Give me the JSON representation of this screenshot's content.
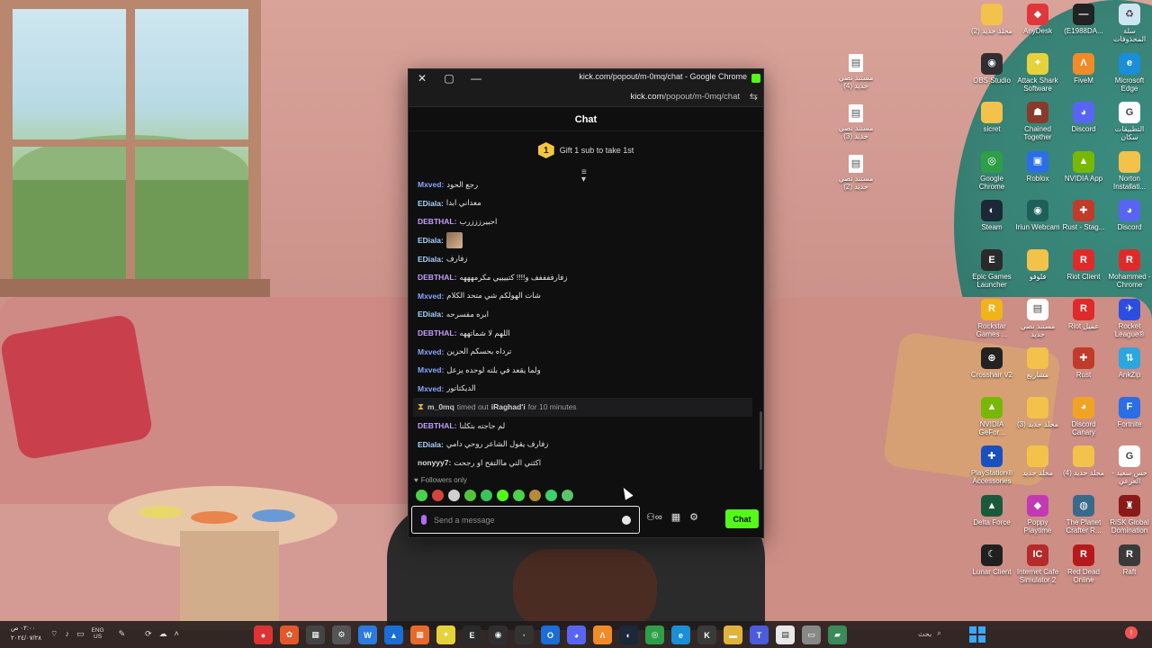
{
  "popup": {
    "title": "kick.com/popout/m-0mq/chat - Google Chrome",
    "url_host": "kick.com",
    "url_path": "/popout/m-0mq/chat",
    "chat_header": "Chat",
    "gift_count": "1",
    "gift_text": "Gift 1 sub to take 1st",
    "followers_only": "Followers only",
    "input_placeholder": "Send a message",
    "chat_button": "Chat",
    "accent": "#53fc18"
  },
  "messages": [
    {
      "user": "Mxved:",
      "text": "رجع الحود",
      "color": "#8aa6ff"
    },
    {
      "user": "EDiala:",
      "text": "معداني ابدا",
      "color": "#a6d2ff"
    },
    {
      "user": "DEBTHAL:",
      "text": "احبيرزززرب",
      "color": "#c79cff"
    },
    {
      "user": "EDiala:",
      "text": "",
      "color": "#a6d2ff",
      "emote": true
    },
    {
      "user": "EDiala:",
      "text": "زفارف",
      "color": "#a6d2ff"
    },
    {
      "user": "DEBTHAL:",
      "text": "زفارففففف و!!!! كتييييي مكرمهههه",
      "color": "#c79cff"
    },
    {
      "user": "Mxved:",
      "text": "شات الهولكم شي متحد الكلام",
      "color": "#8aa6ff"
    },
    {
      "user": "EDiala:",
      "text": "ابره مفسرحه",
      "color": "#a6d2ff"
    },
    {
      "user": "DEBTHAL:",
      "text": "اللهم لا شماتههه",
      "color": "#c79cff"
    },
    {
      "user": "Mxved:",
      "text": "ترداه بحسكم الحزين",
      "color": "#8aa6ff"
    },
    {
      "user": "Mxved:",
      "text": "ولما يقعد في بلته لوحده يزعل",
      "color": "#8aa6ff"
    },
    {
      "user": "Mxved:",
      "text": "الديكتاتور",
      "color": "#8aa6ff"
    },
    {
      "system": true,
      "mod": "m_0mq",
      "action": "timed out",
      "target": "iRaghad'i",
      "duration": "for 10 minutes"
    },
    {
      "user": "DEBTHAL:",
      "text": "لم حاجته بتكلنا",
      "color": "#c79cff"
    },
    {
      "user": "EDiala:",
      "text": "زفارف يقول الشاعر روحي دامي",
      "color": "#a6d2ff"
    },
    {
      "user": "nonyyy7:",
      "text": "اكثني التي ماالتفح او رجحت",
      "color": "#dddddd"
    }
  ],
  "desktop_icons": [
    {
      "label": "(2) مجلد جديد",
      "color": "#f2c24b",
      "glyph": ""
    },
    {
      "label": "AnyDesk",
      "color": "#e0373b",
      "glyph": "◆"
    },
    {
      "label": "(E1988DA...",
      "color": "#222222",
      "glyph": "—"
    },
    {
      "label": "سلة المحذوفات",
      "color": "#cfe6f2",
      "glyph": "♻"
    },
    {
      "label": "OBS Studio",
      "color": "#302e31",
      "glyph": "◉"
    },
    {
      "label": "Attack Shark Software",
      "color": "#e6d23a",
      "glyph": "✦"
    },
    {
      "label": "FiveM",
      "color": "#f28a28",
      "glyph": "Λ"
    },
    {
      "label": "Microsoft Edge",
      "color": "#1a8ed6",
      "glyph": "e"
    },
    {
      "label": "sicret",
      "color": "#f2c24b",
      "glyph": ""
    },
    {
      "label": "Chained Together",
      "color": "#8a3a2a",
      "glyph": "☗"
    },
    {
      "label": "Discord",
      "color": "#5865f2",
      "glyph": "◕"
    },
    {
      "label": "التطبيقات سكان",
      "color": "#ffffff",
      "glyph": "G"
    },
    {
      "label": "Google Chrome",
      "color": "#2e9e48",
      "glyph": "◎"
    },
    {
      "label": "Roblox",
      "color": "#2a6ee8",
      "glyph": "▣"
    },
    {
      "label": "NVIDIA App",
      "color": "#76b900",
      "glyph": "▲"
    },
    {
      "label": "Norton Installati...",
      "color": "#f2c24b",
      "glyph": ""
    },
    {
      "label": "Steam",
      "color": "#1b2838",
      "glyph": "◐"
    },
    {
      "label": "Iriun Webcam",
      "color": "#1f5f5a",
      "glyph": "◉"
    },
    {
      "label": "Rust - Stag...",
      "color": "#c23a2a",
      "glyph": "✚"
    },
    {
      "label": "Discord",
      "color": "#5865f2",
      "glyph": "◕"
    },
    {
      "label": "Epic Games Launcher",
      "color": "#2a2a2a",
      "glyph": "E"
    },
    {
      "label": "فلوفو",
      "color": "#f2c24b",
      "glyph": ""
    },
    {
      "label": "Riot Client",
      "color": "#e02a2a",
      "glyph": "R"
    },
    {
      "label": "Mohammed - Chrome",
      "color": "#e02a2a",
      "glyph": "R"
    },
    {
      "label": "Rockstar Games ...",
      "color": "#f2b31a",
      "glyph": "R"
    },
    {
      "label": "مستند نصي جديد",
      "color": "#ffffff",
      "glyph": "▤"
    },
    {
      "label": "Riot عميل",
      "color": "#e02a2a",
      "glyph": "R"
    },
    {
      "label": "Rocket League®",
      "color": "#2a4fe0",
      "glyph": "✈"
    },
    {
      "label": "Crosshair V2",
      "color": "#222222",
      "glyph": "⊕"
    },
    {
      "label": "مشاريع",
      "color": "#f2c24b",
      "glyph": ""
    },
    {
      "label": "Rust",
      "color": "#c23a2a",
      "glyph": "✚"
    },
    {
      "label": "AnkZip",
      "color": "#2aa6e0",
      "glyph": "⇅"
    },
    {
      "label": "NVIDIA GeFor...",
      "color": "#76b900",
      "glyph": "▲"
    },
    {
      "label": "(3) مجلد جديد",
      "color": "#f2c24b",
      "glyph": ""
    },
    {
      "label": "Discord Canary",
      "color": "#f2a324",
      "glyph": "◕"
    },
    {
      "label": "Fortnite",
      "color": "#2a6ee8",
      "glyph": "F"
    },
    {
      "label": "PlayStation® Accessories",
      "color": "#1a4fbf",
      "glyph": "✚"
    },
    {
      "label": "مجلد جديد",
      "color": "#f2c24b",
      "glyph": ""
    },
    {
      "label": "(4) مجلد جديد",
      "color": "#f2c24b",
      "glyph": ""
    },
    {
      "label": "حس سعيد - العرعي",
      "color": "#ffffff",
      "glyph": "G"
    },
    {
      "label": "Delta Force",
      "color": "#1a5a3a",
      "glyph": "▲"
    },
    {
      "label": "Poppy Playtime",
      "color": "#c23ab3",
      "glyph": "◆"
    },
    {
      "label": "The Planet Crafter R...",
      "color": "#3a6a8a",
      "glyph": "◍"
    },
    {
      "label": "RiSK Global Domination",
      "color": "#8a1a1a",
      "glyph": "♜"
    },
    {
      "label": "Lunar Client",
      "color": "#202020",
      "glyph": "☾"
    },
    {
      "label": "Internet Cafe Simulator 2",
      "color": "#b52a2a",
      "glyph": "IC"
    },
    {
      "label": "Red Dead Online",
      "color": "#b51a1a",
      "glyph": "R"
    },
    {
      "label": "Raft",
      "color": "#3a3a3a",
      "glyph": "R"
    }
  ],
  "desktop_mid_icons": [
    {
      "label": "مستند نصي جديد (4)"
    },
    {
      "label": "مستند نصي جديد (3)"
    },
    {
      "label": "مستند نصي جديد (2)"
    }
  ],
  "taskbar": {
    "clock_time": "٠٢:٠٠ ص",
    "clock_date": "٢٠٢٤/٠٧/٢٨",
    "lang_top": "ENG",
    "lang_bottom": "US",
    "search_label": "بحث",
    "apps": [
      {
        "name": "recorder",
        "color": "#d33",
        "glyph": "●"
      },
      {
        "name": "app-colorful",
        "color": "#e5562a",
        "glyph": "✿"
      },
      {
        "name": "app-calc",
        "color": "#444",
        "glyph": "▦"
      },
      {
        "name": "app-settings",
        "color": "#555",
        "glyph": "⚙"
      },
      {
        "name": "app-w",
        "color": "#2a7ae0",
        "glyph": "W"
      },
      {
        "name": "app-store",
        "color": "#1a6ed6",
        "glyph": "▲"
      },
      {
        "name": "app-windows",
        "color": "#e86a2a",
        "glyph": "▦"
      },
      {
        "name": "app-attack",
        "color": "#e6d23a",
        "glyph": "✦"
      },
      {
        "name": "app-epic",
        "color": "#2a2a2a",
        "glyph": "E"
      },
      {
        "name": "app-obs",
        "color": "#302e31",
        "glyph": "◉"
      },
      {
        "name": "app-dot",
        "color": "#333",
        "glyph": "·"
      },
      {
        "name": "app-outlook",
        "color": "#1a6ed6",
        "glyph": "O"
      },
      {
        "name": "app-discord",
        "color": "#5865f2",
        "glyph": "◕"
      },
      {
        "name": "app-fivem",
        "color": "#f28a28",
        "glyph": "Λ"
      },
      {
        "name": "app-steam",
        "color": "#1b2838",
        "glyph": "◐"
      },
      {
        "name": "app-chrome",
        "color": "#2e9e48",
        "glyph": "◎"
      },
      {
        "name": "app-edge",
        "color": "#1a8ed6",
        "glyph": "e"
      },
      {
        "name": "app-kick",
        "color": "#3a3a3a",
        "glyph": "K"
      },
      {
        "name": "app-explorer",
        "color": "#e0b33a",
        "glyph": "▬"
      },
      {
        "name": "app-teams",
        "color": "#4a5be0",
        "glyph": "T"
      },
      {
        "name": "app-notes",
        "color": "#e8e8e8",
        "glyph": "▤"
      },
      {
        "name": "app-gray",
        "color": "#888",
        "glyph": "▭"
      },
      {
        "name": "app-wallpaper",
        "color": "#3a8a5a",
        "glyph": "▰"
      }
    ]
  }
}
